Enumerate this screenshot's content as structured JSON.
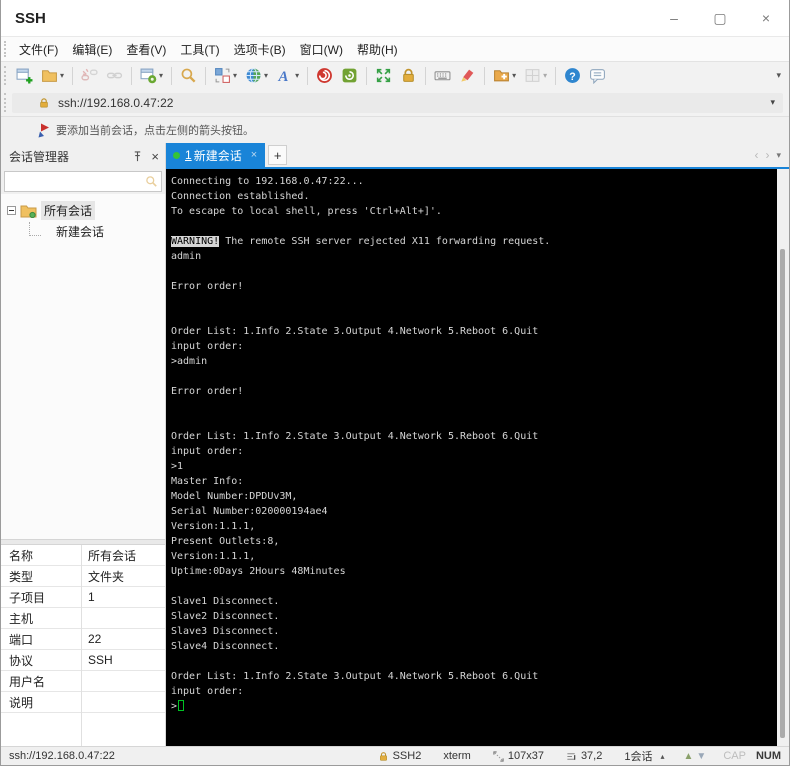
{
  "colors": {
    "accent_blue": "#1984d8",
    "terminal_bg": "#000000",
    "terminal_fg": "#d6d6d6",
    "cursor_green": "#00c223",
    "tab_dot_green": "#36c336",
    "lock_gold": "#e3ad3c"
  },
  "window": {
    "title": "SSH",
    "minimize": "–",
    "maximize": "▢",
    "close": "×"
  },
  "menubar": {
    "items": [
      "文件(F)",
      "编辑(E)",
      "查看(V)",
      "工具(T)",
      "选项卡(B)",
      "窗口(W)",
      "帮助(H)"
    ]
  },
  "toolbar": {
    "dropdown_glyph": "▾",
    "overflow_glyph": "▾",
    "groups": [
      [
        {
          "name": "new-session-icon"
        },
        {
          "name": "open-session-icon",
          "dropdown": true
        }
      ],
      [
        {
          "name": "disconnect-icon",
          "disabled": true
        },
        {
          "name": "reconnect-icon",
          "disabled": true
        }
      ],
      [
        {
          "name": "session-properties-icon",
          "dropdown": true
        }
      ],
      [
        {
          "name": "find-icon"
        }
      ],
      [
        {
          "name": "compose-icon",
          "dropdown": true
        },
        {
          "name": "globe-icon",
          "dropdown": true
        },
        {
          "name": "font-icon",
          "dropdown": true
        }
      ],
      [
        {
          "name": "xagent-icon"
        },
        {
          "name": "package-icon"
        }
      ],
      [
        {
          "name": "fullscreen-icon"
        },
        {
          "name": "lock-icon"
        }
      ],
      [
        {
          "name": "keyboard-icon"
        },
        {
          "name": "highlighter-icon"
        }
      ],
      [
        {
          "name": "new-folder-icon",
          "dropdown": true
        },
        {
          "name": "window-layout-icon",
          "dropdown": true,
          "disabled": true
        }
      ],
      [
        {
          "name": "help-icon"
        },
        {
          "name": "feedback-icon"
        }
      ]
    ]
  },
  "addressbar": {
    "value": "ssh://192.168.0.47:22",
    "dropdown_glyph": "▾"
  },
  "notebar": {
    "text": "要添加当前会话，点击左侧的箭头按钮。"
  },
  "session_manager": {
    "title": "会话管理器",
    "search_value": "",
    "tree": [
      {
        "label": "所有会话"
      },
      {
        "label": "新建会话"
      }
    ]
  },
  "tabs": {
    "active": {
      "index": "1",
      "label": "新建会话",
      "close_glyph": "×"
    },
    "new_tab_glyph": "+",
    "nav": {
      "prev": "‹",
      "next": "›",
      "menu": "▾"
    }
  },
  "terminal": {
    "lines": [
      {
        "text": "Connecting to 192.168.0.47:22..."
      },
      {
        "text": "Connection established."
      },
      {
        "text": "To escape to local shell, press 'Ctrl+Alt+]'."
      },
      {
        "text": ""
      },
      {
        "segments": [
          {
            "text": "WARNING!",
            "style": "inverted"
          },
          {
            "text": " The remote SSH server rejected X11 forwarding request."
          }
        ]
      },
      {
        "text": "admin"
      },
      {
        "text": ""
      },
      {
        "text": "Error order!"
      },
      {
        "text": ""
      },
      {
        "text": ""
      },
      {
        "text": "Order List: 1.Info 2.State 3.Output 4.Network 5.Reboot 6.Quit"
      },
      {
        "text": "input order:"
      },
      {
        "text": ">admin"
      },
      {
        "text": ""
      },
      {
        "text": "Error order!"
      },
      {
        "text": ""
      },
      {
        "text": ""
      },
      {
        "text": "Order List: 1.Info 2.State 3.Output 4.Network 5.Reboot 6.Quit"
      },
      {
        "text": "input order:"
      },
      {
        "text": ">1"
      },
      {
        "text": "Master Info:"
      },
      {
        "text": "Model Number:DPDUv3M,"
      },
      {
        "text": "Serial Number:020000194ae4"
      },
      {
        "text": "Version:1.1.1,"
      },
      {
        "text": "Present Outlets:8,"
      },
      {
        "text": "Version:1.1.1,"
      },
      {
        "text": "Uptime:0Days 2Hours 48Minutes"
      },
      {
        "text": ""
      },
      {
        "text": "Slave1 Disconnect."
      },
      {
        "text": "Slave2 Disconnect."
      },
      {
        "text": "Slave3 Disconnect."
      },
      {
        "text": "Slave4 Disconnect."
      },
      {
        "text": ""
      },
      {
        "text": "Order List: 1.Info 2.State 3.Output 4.Network 5.Reboot 6.Quit"
      },
      {
        "text": "input order:"
      },
      {
        "text": ">",
        "cursor": true
      }
    ]
  },
  "properties": {
    "rows": [
      {
        "label": "名称",
        "value": "所有会话"
      },
      {
        "label": "类型",
        "value": "文件夹"
      },
      {
        "label": "子项目",
        "value": "1"
      },
      {
        "label": "主机",
        "value": ""
      },
      {
        "label": "端口",
        "value": "22"
      },
      {
        "label": "协议",
        "value": "SSH"
      },
      {
        "label": "用户名",
        "value": ""
      },
      {
        "label": "说明",
        "value": ""
      }
    ]
  },
  "statusbar": {
    "left": "ssh://192.168.0.47:22",
    "protocol": "SSH2",
    "term_type": "xterm",
    "size": "107x37",
    "cursor_pos": "37,2",
    "session_count": "1会话",
    "caret": "▴",
    "up_arrow": "▲",
    "down_arrow": "▼",
    "cap": "CAP",
    "num": "NUM"
  }
}
